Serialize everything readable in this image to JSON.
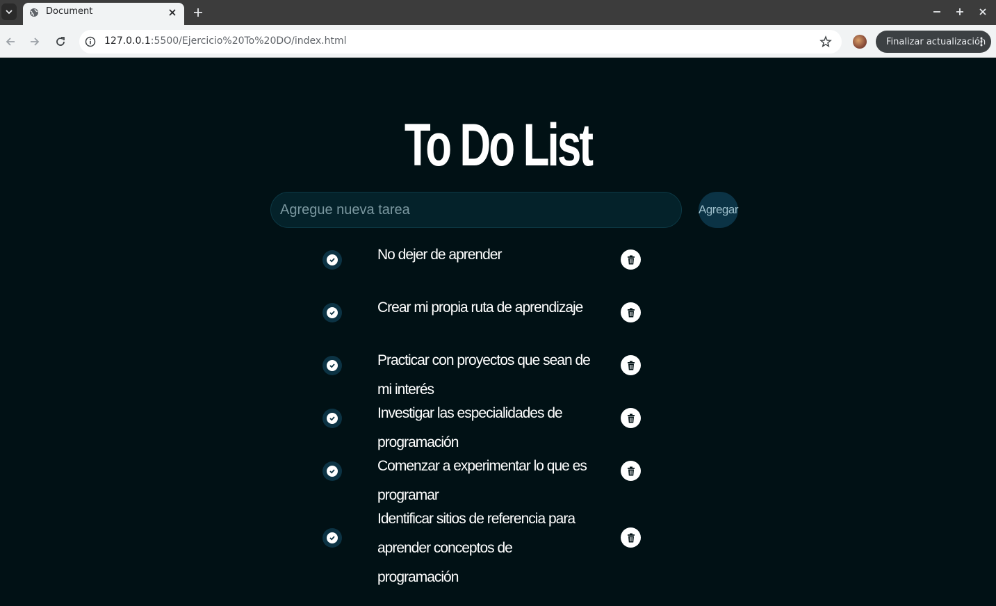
{
  "browser": {
    "tab_title": "Document",
    "url_host": "127.0.0.1",
    "url_path": ":5500/Ejercicio%20To%20DO/index.html",
    "update_button": "Finalizar actualización"
  },
  "app": {
    "title": "To Do List",
    "input_placeholder": "Agregue nueva tarea",
    "input_value": "",
    "add_button": "Agregar"
  },
  "tasks": [
    {
      "text": "No dejer de aprender"
    },
    {
      "text": "Crear mi propia ruta de aprendizaje"
    },
    {
      "text": "Practicar con proyectos que sean de mi interés"
    },
    {
      "text": "Investigar las especialidades de programación"
    },
    {
      "text": "Comenzar a experimentar lo que es programar"
    },
    {
      "text": "Identificar sitios de referencia para aprender conceptos de programación"
    }
  ],
  "colors": {
    "background": "#011115",
    "accent": "#0c3344",
    "text": "#ffffff"
  },
  "icons": {
    "check": "check-circle-icon",
    "delete": "trash-icon"
  }
}
